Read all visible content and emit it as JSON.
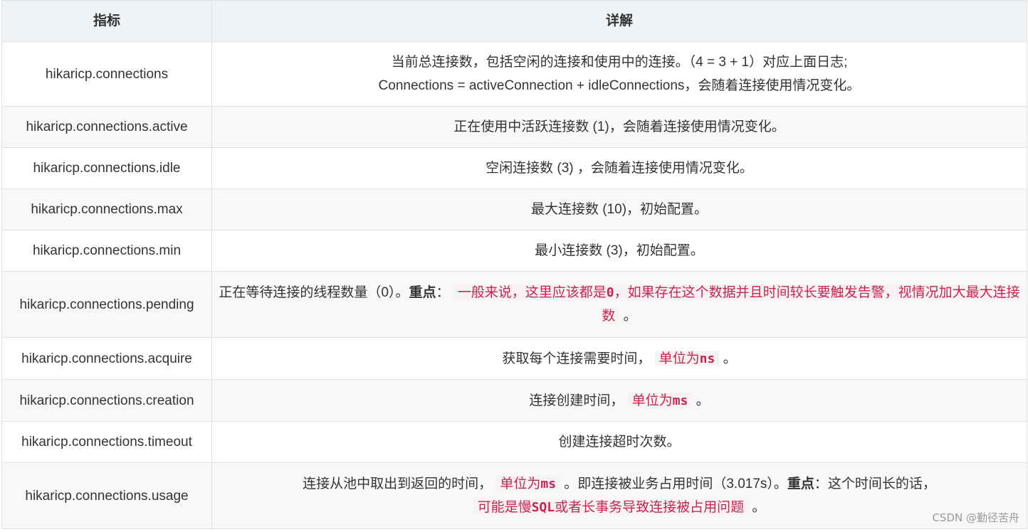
{
  "table": {
    "headers": [
      "指标",
      "详解"
    ],
    "rows": [
      {
        "metric": "hikaricp.connections",
        "detail_line1": "当前总连接数，包括空闲的连接和使用中的连接。（4 = 3 + 1）对应上面日志;",
        "detail_line2": "Connections = activeConnection + idleConnections，会随着连接使用情况变化。"
      },
      {
        "metric": "hikaricp.connections.active",
        "detail": "正在使用中活跃连接数 (1)，会随着连接使用情况变化。"
      },
      {
        "metric": "hikaricp.connections.idle",
        "detail": "空闲连接数 (3) ，会随着连接使用情况变化。"
      },
      {
        "metric": "hikaricp.connections.max",
        "detail": "最大连接数 (10)，初始配置。"
      },
      {
        "metric": "hikaricp.connections.min",
        "detail": "最小连接数 (3)，初始配置。"
      },
      {
        "metric": "hikaricp.connections.pending",
        "detail_prefix": "正在等待连接的线程数量（0）。",
        "emphasis": "重点",
        "colon": "：",
        "highlight_a": "一般来说，这里应该都是",
        "highlight_code": "0",
        "highlight_b": "，如果存在这个数据并且时间较长要触发告警，视情况加大最大连接数",
        "detail_suffix": " 。"
      },
      {
        "metric": "hikaricp.connections.acquire",
        "detail_prefix": "获取每个连接需要时间，",
        "highlight_a": "单位为",
        "highlight_code": "ns",
        "detail_suffix": " 。"
      },
      {
        "metric": "hikaricp.connections.creation",
        "detail_prefix": "连接创建时间，",
        "highlight_a": "单位为",
        "highlight_code": "ms",
        "detail_suffix": " 。"
      },
      {
        "metric": "hikaricp.connections.timeout",
        "detail": "创建连接超时次数。"
      },
      {
        "metric": "hikaricp.connections.usage",
        "detail_prefix": "连接从池中取出到返回的时间，",
        "highlight1_a": "单位为",
        "highlight1_code": "ms",
        "detail_mid": " 。即连接被业务占用时间（3.017s）。",
        "emphasis": "重点",
        "detail_mid2": "：这个时间长的话，",
        "highlight2_a": "可能是慢",
        "highlight2_code": "SQL",
        "highlight2_b": "或者长事务导致连接被占用问题",
        "detail_suffix": " 。"
      }
    ]
  },
  "watermark": "CSDN @勤径苦舟",
  "colors": {
    "header_bg": "#eff3f5",
    "alt_row_bg": "#f8f8f8",
    "border": "#dfe2e5",
    "highlight_text": "#c7254e",
    "highlight_bg": "#f9f2f4"
  }
}
